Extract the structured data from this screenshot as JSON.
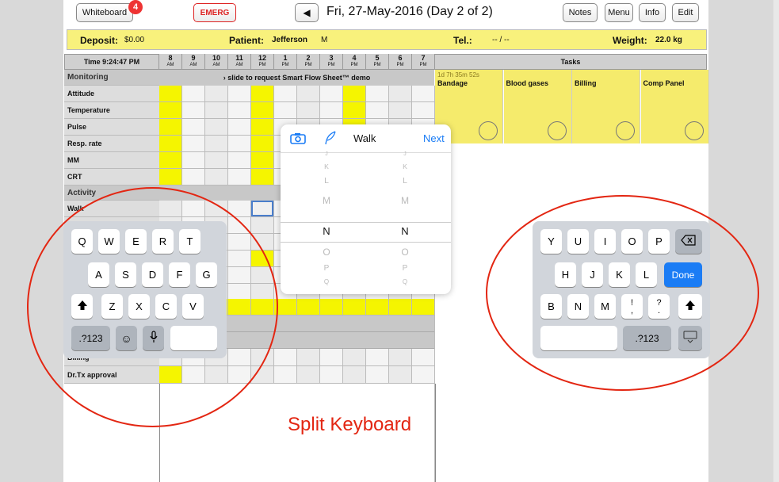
{
  "toolbar": {
    "whiteboard_label": "Whiteboard",
    "whiteboard_badge": "4",
    "emerg_label": "EMERG",
    "prev_glyph": "◀",
    "date_title": "Fri, 27-May-2016 (Day 2 of 2)",
    "notes_label": "Notes",
    "menu_label": "Menu",
    "info_label": "Info",
    "edit_label": "Edit"
  },
  "patient_bar": {
    "deposit_label": "Deposit:",
    "deposit_value": "$0.00",
    "patient_label": "Patient:",
    "patient_name": "Jefferson",
    "patient_sex": "M",
    "tel_label": "Tel.:",
    "tel_value": "-- / --",
    "weight_label": "Weight:",
    "weight_value": "22.0 kg"
  },
  "grid": {
    "time_label": "Time 9:24:47 PM",
    "hours": [
      {
        "h": "8",
        "ap": "AM"
      },
      {
        "h": "9",
        "ap": "AM"
      },
      {
        "h": "10",
        "ap": "AM"
      },
      {
        "h": "11",
        "ap": "AM"
      },
      {
        "h": "12",
        "ap": "PM"
      },
      {
        "h": "1",
        "ap": "PM"
      },
      {
        "h": "2",
        "ap": "PM"
      },
      {
        "h": "3",
        "ap": "PM"
      },
      {
        "h": "4",
        "ap": "PM"
      },
      {
        "h": "5",
        "ap": "PM"
      },
      {
        "h": "6",
        "ap": "PM"
      },
      {
        "h": "7",
        "ap": "PM"
      }
    ],
    "tasks_header": "Tasks",
    "monitoring_label": "Monitoring",
    "slide_banner": "› slide to request Smart Flow Sheet™ demo",
    "rows_top": [
      "Attitude",
      "Temperature",
      "Pulse",
      "Resp. rate",
      "MM",
      "CRT"
    ],
    "activity_label": "Activity",
    "walk_label": "Walk",
    "billing_label": "Billing",
    "drtx_label": "Dr.Tx approval"
  },
  "tasks": [
    {
      "name": "Bandage",
      "timer": "1d 7h 35m 52s"
    },
    {
      "name": "Blood gases",
      "timer": ""
    },
    {
      "name": "Billing",
      "timer": ""
    },
    {
      "name": "Comp Panel",
      "timer": ""
    }
  ],
  "picker": {
    "title": "Walk",
    "next_label": "Next",
    "col_letters": [
      "J",
      "K",
      "L",
      "M"
    ],
    "selected_letter": "N",
    "below_letters": [
      "O",
      "P",
      "Q"
    ]
  },
  "keyboard_left": {
    "row1": [
      "Q",
      "W",
      "E",
      "R",
      "T"
    ],
    "row2": [
      "A",
      "S",
      "D",
      "F",
      "G"
    ],
    "row3": [
      "Z",
      "X",
      "C",
      "V"
    ],
    "numbers_label": ".?123"
  },
  "keyboard_right": {
    "row1": [
      "Y",
      "U",
      "I",
      "O",
      "P"
    ],
    "row2": [
      "H",
      "J",
      "K",
      "L"
    ],
    "row3": [
      "B",
      "N",
      "M",
      "!",
      "?"
    ],
    "row3_sub": [
      ",",
      "."
    ],
    "done_label": "Done",
    "numbers_label": ".?123"
  },
  "annotation": {
    "caption": "Split Keyboard",
    "color": "#e32612"
  },
  "colors": {
    "highlight_yellow": "#f5f500",
    "task_yellow": "#f5eb6c",
    "ios_blue": "#1a7cf5"
  }
}
